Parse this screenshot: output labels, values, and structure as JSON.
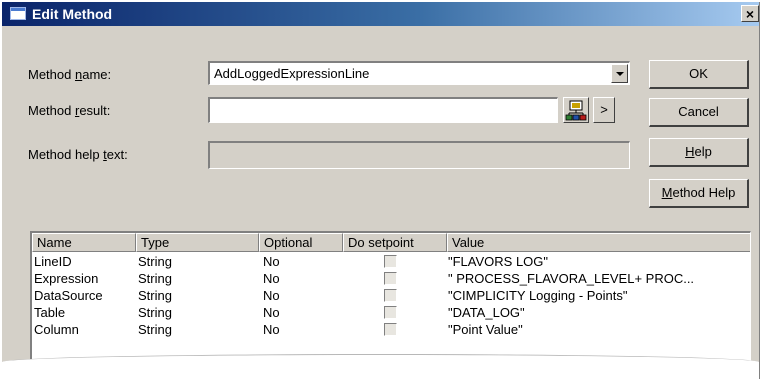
{
  "window": {
    "title": "Edit Method",
    "close_glyph": "×"
  },
  "form": {
    "method_name": {
      "label_pre": "Method ",
      "label_key": "n",
      "label_post": "ame:",
      "value": "AddLoggedExpressionLine"
    },
    "method_result": {
      "label_pre": "Method ",
      "label_key": "r",
      "label_post": "esult:",
      "value": ""
    },
    "method_help_text": {
      "label_pre": "Method help ",
      "label_key": "t",
      "label_post": "ext:",
      "value": ""
    },
    "more_glyph": ">"
  },
  "buttons": {
    "ok": "OK",
    "cancel": "Cancel",
    "help_key": "H",
    "help_rest": "elp",
    "method_help_key": "M",
    "method_help_rest": "ethod Help"
  },
  "table": {
    "columns": [
      "Name",
      "Type",
      "Optional",
      "Do setpoint",
      "Value"
    ],
    "rows": [
      {
        "name": "LineID",
        "type": "String",
        "optional": "No",
        "setpoint": false,
        "value": "\"FLAVORS LOG\""
      },
      {
        "name": "Expression",
        "type": "String",
        "optional": "No",
        "setpoint": false,
        "value": "\" PROCESS_FLAVORA_LEVEL+ PROC..."
      },
      {
        "name": "DataSource",
        "type": "String",
        "optional": "No",
        "setpoint": false,
        "value": "\"CIMPLICITY Logging - Points\""
      },
      {
        "name": "Table",
        "type": "String",
        "optional": "No",
        "setpoint": false,
        "value": "\"DATA_LOG\""
      },
      {
        "name": "Column",
        "type": "String",
        "optional": "No",
        "setpoint": false,
        "value": "\"Point Value\""
      }
    ]
  }
}
